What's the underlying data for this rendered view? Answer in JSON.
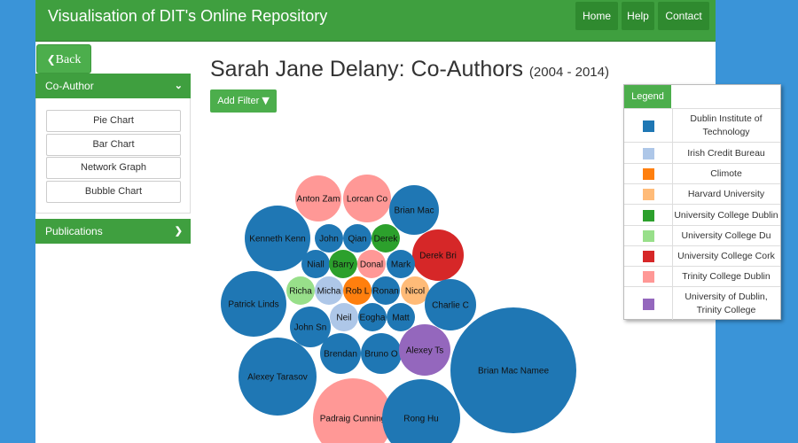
{
  "header": {
    "brand": "Visualisation of DIT's Online Repository",
    "nav": [
      {
        "label": "Home"
      },
      {
        "label": "Help"
      },
      {
        "label": "Contact"
      }
    ]
  },
  "sidebar": {
    "back_label": "Back",
    "coauthor_title": "Co-Author",
    "buttons": [
      {
        "label": "Pie Chart"
      },
      {
        "label": "Bar Chart"
      },
      {
        "label": "Network Graph"
      },
      {
        "label": "Bubble Chart"
      }
    ],
    "publications_title": "Publications"
  },
  "main": {
    "title": "Sarah Jane Delany: Co-Authors",
    "years": "(2004 - 2014)",
    "filter_label": "Add Filter"
  },
  "legend": {
    "title": "Legend",
    "items": [
      {
        "label": "Dublin Institute of Technology",
        "color": "#1f77b4"
      },
      {
        "label": "Irish Credit Bureau",
        "color": "#aec7e8"
      },
      {
        "label": "Climote",
        "color": "#ff7f0e"
      },
      {
        "label": "Harvard University",
        "color": "#ffbb78"
      },
      {
        "label": "University College Dublin",
        "color": "#2ca02c"
      },
      {
        "label": "University College Du",
        "color": "#98df8a"
      },
      {
        "label": "University College Cork",
        "color": "#d62728"
      },
      {
        "label": "Trinity College Dublin",
        "color": "#ff9896"
      },
      {
        "label": "University of Dublin, Trinity College",
        "color": "#9467bd"
      }
    ]
  },
  "chart_data": {
    "type": "bubble",
    "bubbles": [
      {
        "label": "Anton Zam",
        "org": 7
      },
      {
        "label": "Lorcan Co",
        "org": 7
      },
      {
        "label": "Brian Mac",
        "org": 0
      },
      {
        "label": "Kenneth Kenn",
        "org": 0
      },
      {
        "label": "John",
        "org": 0
      },
      {
        "label": "Qian",
        "org": 0
      },
      {
        "label": "Derek",
        "org": 4
      },
      {
        "label": "Derek Bri",
        "org": 6
      },
      {
        "label": "Niall",
        "org": 0
      },
      {
        "label": "Barry",
        "org": 4
      },
      {
        "label": "Donal",
        "org": 7
      },
      {
        "label": "Mark",
        "org": 0
      },
      {
        "label": "Patrick Linds",
        "org": 0
      },
      {
        "label": "Richa",
        "org": 5
      },
      {
        "label": "Micha",
        "org": 1
      },
      {
        "label": "Rob L",
        "org": 2
      },
      {
        "label": "Ronan",
        "org": 0
      },
      {
        "label": "Nicol",
        "org": 3
      },
      {
        "label": "Charlie C",
        "org": 0
      },
      {
        "label": "John Sn",
        "org": 0
      },
      {
        "label": "Neil",
        "org": 1
      },
      {
        "label": "Eogha",
        "org": 0
      },
      {
        "label": "Matt",
        "org": 0
      },
      {
        "label": "Brendan",
        "org": 0
      },
      {
        "label": "Bruno O",
        "org": 0
      },
      {
        "label": "Alexey Ts",
        "org": 8
      },
      {
        "label": "Alexey Tarasov",
        "org": 0
      },
      {
        "label": "Brian Mac Namee",
        "org": 0
      },
      {
        "label": "Padraig Cunning",
        "org": 7
      },
      {
        "label": "Rong Hu",
        "org": 0
      }
    ]
  }
}
